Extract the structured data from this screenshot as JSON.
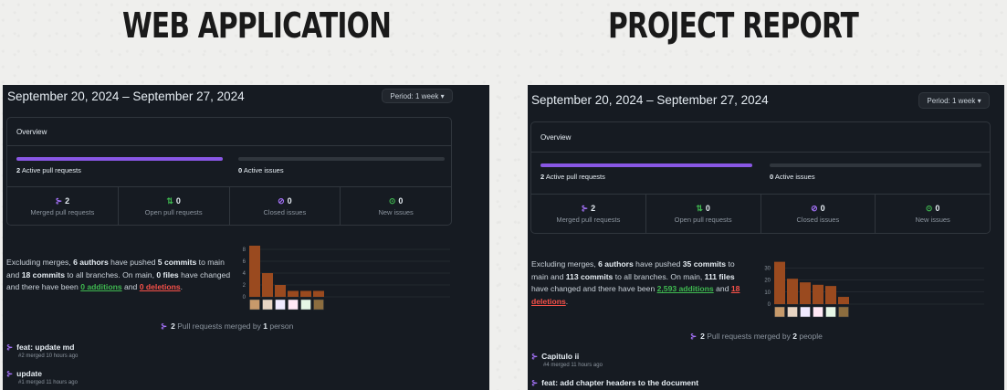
{
  "left": {
    "heading": "WEB APPLICATION",
    "date_range": "September 20, 2024 – September 27, 2024",
    "period": "Period: 1 week ▾",
    "overview_title": "Overview",
    "active_pr": {
      "count": "2",
      "label": " Active pull requests",
      "fill": 1.0
    },
    "active_issues": {
      "count": "0",
      "label": " Active issues",
      "fill": 0.0
    },
    "stats": [
      {
        "icon": "⊱",
        "value": "2",
        "label": "Merged pull requests",
        "color": "#a371f7"
      },
      {
        "icon": "⇅",
        "value": "0",
        "label": "Open pull requests",
        "color": "#3fb950"
      },
      {
        "icon": "⊘",
        "value": "0",
        "label": "Closed issues",
        "color": "#a371f7"
      },
      {
        "icon": "⊙",
        "value": "0",
        "label": "New issues",
        "color": "#3fb950"
      }
    ],
    "summary": {
      "p1": "Excluding merges, ",
      "authors": "6 authors",
      "p2": " have pushed ",
      "commits_main": "5 commits",
      "p3": " to main and ",
      "commits_all": "18 commits",
      "p4": " to all branches. On main, ",
      "files": "0 files",
      "p5": " have changed and there have been ",
      "additions": "0 additions",
      "p6": " and ",
      "deletions": "0 deletions",
      "p7": "."
    },
    "chart_data": {
      "type": "bar",
      "values": [
        9,
        4,
        2,
        1,
        1,
        1
      ],
      "ylim": [
        0,
        8
      ],
      "yticks": [
        "8",
        "6",
        "4",
        "2",
        "0"
      ],
      "bar_color": "#9a4a1f"
    },
    "merged": {
      "pre": " ",
      "count": "2",
      "mid": " Pull requests merged by ",
      "who": "1",
      "post": " person"
    },
    "prs": [
      {
        "title": "feat: update md",
        "meta": "#2 merged 10 hours ago"
      },
      {
        "title": "update",
        "meta": "#1 merged 11 hours ago"
      }
    ]
  },
  "right": {
    "heading": "PROJECT REPORT",
    "date_range": "September 20, 2024 – September 27, 2024",
    "period": "Period: 1 week ▾",
    "overview_title": "Overview",
    "active_pr": {
      "count": "2",
      "label": " Active pull requests",
      "fill": 1.0
    },
    "active_issues": {
      "count": "0",
      "label": " Active issues",
      "fill": 0.0
    },
    "stats": [
      {
        "icon": "⊱",
        "value": "2",
        "label": "Merged pull requests",
        "color": "#a371f7"
      },
      {
        "icon": "⇅",
        "value": "0",
        "label": "Open pull requests",
        "color": "#3fb950"
      },
      {
        "icon": "⊘",
        "value": "0",
        "label": "Closed issues",
        "color": "#a371f7"
      },
      {
        "icon": "⊙",
        "value": "0",
        "label": "New issues",
        "color": "#3fb950"
      }
    ],
    "summary": {
      "p1": "Excluding merges, ",
      "authors": "6 authors",
      "p2": " have pushed ",
      "commits_main": "35 commits",
      "p3": " to main and ",
      "commits_all": "113 commits",
      "p4": " to all branches. On main, ",
      "files": "111 files",
      "p5": " have changed and there have been ",
      "additions": "2,593 additions",
      "p6": " and ",
      "deletions": "18 deletions",
      "p7": "."
    },
    "chart_data": {
      "type": "bar",
      "values": [
        35,
        21,
        18,
        16,
        15,
        6
      ],
      "ylim": [
        0,
        40
      ],
      "yticks": [
        "30",
        "20",
        "10",
        "0"
      ],
      "bar_color": "#9a4a1f"
    },
    "merged": {
      "pre": " ",
      "count": "2",
      "mid": " Pull requests merged by ",
      "who": "2",
      "post": " people"
    },
    "prs": [
      {
        "title": "Capitulo ii",
        "meta": "#4 merged 11 hours ago"
      },
      {
        "title": "feat: add chapter headers to the document",
        "meta": ""
      }
    ]
  }
}
